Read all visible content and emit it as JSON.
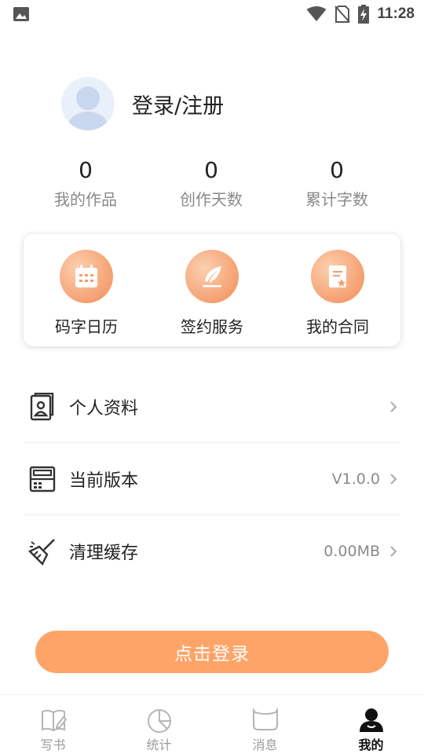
{
  "status_bar": {
    "time": "11:28"
  },
  "profile": {
    "title": "登录/注册"
  },
  "stats": [
    {
      "value": "0",
      "label": "我的作品"
    },
    {
      "value": "0",
      "label": "创作天数"
    },
    {
      "value": "0",
      "label": "累计字数"
    }
  ],
  "features": [
    {
      "label": "码字日历",
      "icon": "calendar-icon"
    },
    {
      "label": "签约服务",
      "icon": "feather-icon"
    },
    {
      "label": "我的合同",
      "icon": "contract-icon"
    }
  ],
  "menu": [
    {
      "label": "个人资料",
      "value": "",
      "icon": "profile-card-icon"
    },
    {
      "label": "当前版本",
      "value": "V1.0.0",
      "icon": "version-icon"
    },
    {
      "label": "清理缓存",
      "value": "0.00MB",
      "icon": "broom-icon"
    }
  ],
  "login_button": "点击登录",
  "nav": [
    {
      "label": "写书",
      "icon": "write-book-icon",
      "active": false
    },
    {
      "label": "统计",
      "icon": "pie-chart-icon",
      "active": false
    },
    {
      "label": "消息",
      "icon": "message-icon",
      "active": false
    },
    {
      "label": "我的",
      "icon": "user-icon",
      "active": true
    }
  ],
  "colors": {
    "accent": "#ffa468",
    "feature_circle": "#f59c6c",
    "muted_text": "#8a8a8a"
  }
}
